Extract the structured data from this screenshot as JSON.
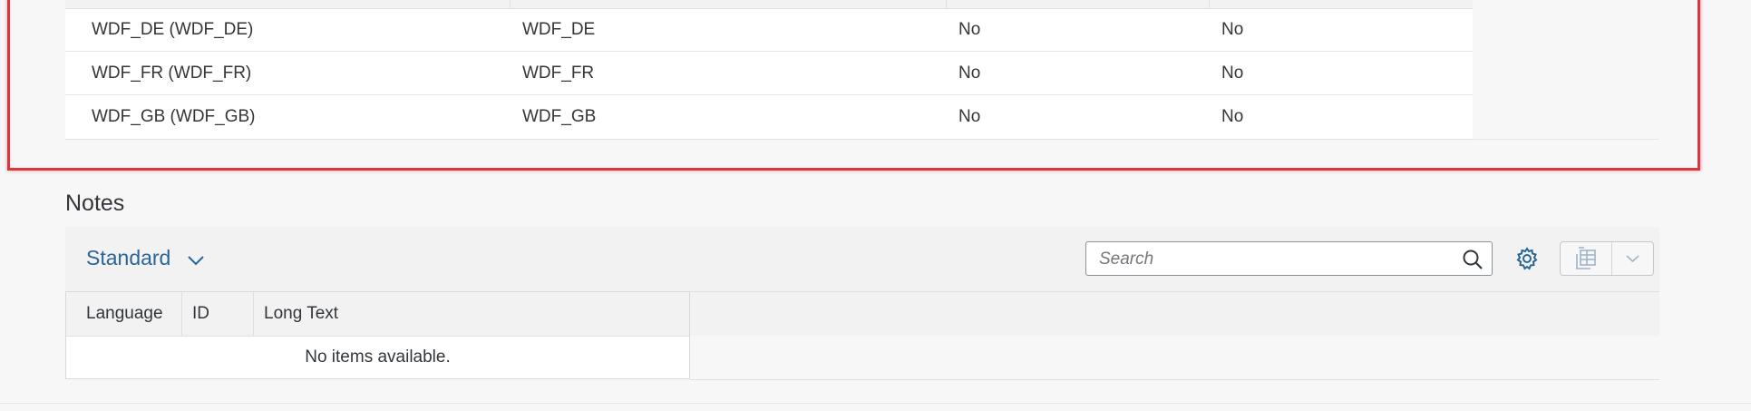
{
  "top_table": {
    "rows": [
      {
        "c1": "WDF_DE (WDF_DE)",
        "c2": "WDF_DE",
        "c3": "No",
        "c4": "No"
      },
      {
        "c1": "WDF_FR (WDF_FR)",
        "c2": "WDF_FR",
        "c3": "No",
        "c4": "No"
      },
      {
        "c1": "WDF_GB (WDF_GB)",
        "c2": "WDF_GB",
        "c3": "No",
        "c4": "No"
      }
    ]
  },
  "notes": {
    "title": "Notes",
    "variant": "Standard",
    "search_placeholder": "Search",
    "columns": [
      "Language",
      "ID",
      "Long Text"
    ],
    "empty_text": "No items available."
  },
  "colors": {
    "highlight": "#d9363e",
    "link": "#2b6496"
  },
  "icons": {
    "variant_dropdown": "chevron-down-icon",
    "search": "search-icon",
    "settings": "gear-icon",
    "export": "spreadsheet-export-icon",
    "export_menu": "chevron-down-icon"
  }
}
